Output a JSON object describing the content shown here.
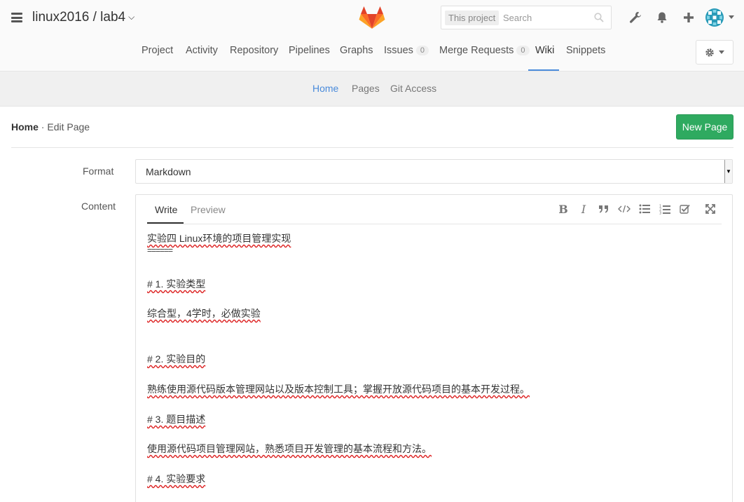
{
  "header": {
    "project_title": "linux2016 / lab4",
    "search_scope": "This project",
    "search_placeholder": "Search"
  },
  "nav": {
    "items": [
      {
        "label": "Project"
      },
      {
        "label": "Activity"
      },
      {
        "label": "Repository"
      },
      {
        "label": "Pipelines"
      },
      {
        "label": "Graphs"
      },
      {
        "label": "Issues",
        "count": "0"
      },
      {
        "label": "Merge Requests",
        "count": "0"
      },
      {
        "label": "Wiki",
        "active": true
      },
      {
        "label": "Snippets"
      }
    ]
  },
  "subnav": {
    "items": [
      {
        "label": "Home",
        "active": true
      },
      {
        "label": "Pages"
      },
      {
        "label": "Git Access"
      }
    ]
  },
  "page": {
    "crumb_title": "Home",
    "crumb_sep": " · ",
    "crumb_action": "Edit Page",
    "new_page_label": "New Page"
  },
  "form": {
    "format_label": "Format",
    "format_value": "Markdown",
    "content_label": "Content",
    "tab_write": "Write",
    "tab_preview": "Preview"
  },
  "editor_lines": [
    "实验四 Linux环境的项目管理实现",
    "======",
    "# 1. 实验类型",
    "综合型，4学时，必做实验",
    "# 2.  实验目的",
    "熟练使用源代码版本管理网站以及版本控制工具；掌握开放源代码项目的基本开发过程。",
    "# 3. 题目描述",
    "使用源代码项目管理网站，熟悉项目开发管理的基本流程和方法。",
    "# 4. 实验要求"
  ],
  "colors": {
    "accent": "#4a8bdb",
    "success": "#2faa60",
    "logo_orange": "#e24329"
  }
}
